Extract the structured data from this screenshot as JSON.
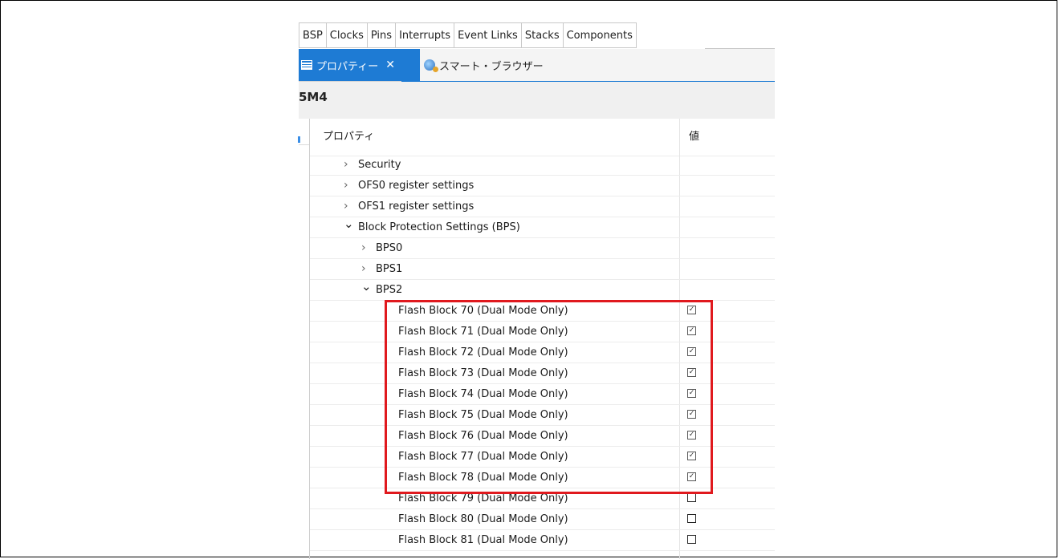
{
  "tabs": [
    "BSP",
    "Clocks",
    "Pins",
    "Interrupts",
    "Event Links",
    "Stacks",
    "Components"
  ],
  "views": {
    "properties_label": "プロパティー",
    "browser_label": "スマート・ブラウザー"
  },
  "title": "5M4",
  "columns": {
    "property": "プロパティ",
    "value": "値"
  },
  "rows": [
    {
      "label": "Security",
      "expander": "collapsed",
      "indent": 1
    },
    {
      "label": "OFS0 register settings",
      "expander": "collapsed",
      "indent": 1
    },
    {
      "label": "OFS1 register settings",
      "expander": "collapsed",
      "indent": 1
    },
    {
      "label": "Block Protection Settings (BPS)",
      "expander": "expanded",
      "indent": 1
    },
    {
      "label": "BPS0",
      "expander": "collapsed",
      "indent": 2
    },
    {
      "label": "BPS1",
      "expander": "collapsed",
      "indent": 2
    },
    {
      "label": "BPS2",
      "expander": "expanded",
      "indent": 2
    },
    {
      "label": "Flash Block 70 (Dual Mode Only)",
      "checked": true,
      "indent": 3
    },
    {
      "label": "Flash Block 71 (Dual Mode Only)",
      "checked": true,
      "indent": 3
    },
    {
      "label": "Flash Block 72 (Dual Mode Only)",
      "checked": true,
      "indent": 3
    },
    {
      "label": "Flash Block 73 (Dual Mode Only)",
      "checked": true,
      "indent": 3
    },
    {
      "label": "Flash Block 74 (Dual Mode Only)",
      "checked": true,
      "indent": 3
    },
    {
      "label": "Flash Block 75 (Dual Mode Only)",
      "checked": true,
      "indent": 3
    },
    {
      "label": "Flash Block 76 (Dual Mode Only)",
      "checked": true,
      "indent": 3
    },
    {
      "label": "Flash Block 77 (Dual Mode Only)",
      "checked": true,
      "indent": 3
    },
    {
      "label": "Flash Block 78 (Dual Mode Only)",
      "checked": true,
      "indent": 3
    },
    {
      "label": "Flash Block 79 (Dual Mode Only)",
      "checked": false,
      "indent": 3
    },
    {
      "label": "Flash Block 80 (Dual Mode Only)",
      "checked": false,
      "indent": 3
    },
    {
      "label": "Flash Block 81 (Dual Mode Only)",
      "checked": false,
      "indent": 3
    }
  ],
  "icons": {
    "properties_view": "table-icon",
    "browser_view": "globe-icon",
    "close": "close-icon",
    "collapsed": "chevron-right-icon",
    "expanded": "chevron-down-icon"
  },
  "colors": {
    "accent": "#1e7bd4",
    "highlight": "#e0191e"
  }
}
